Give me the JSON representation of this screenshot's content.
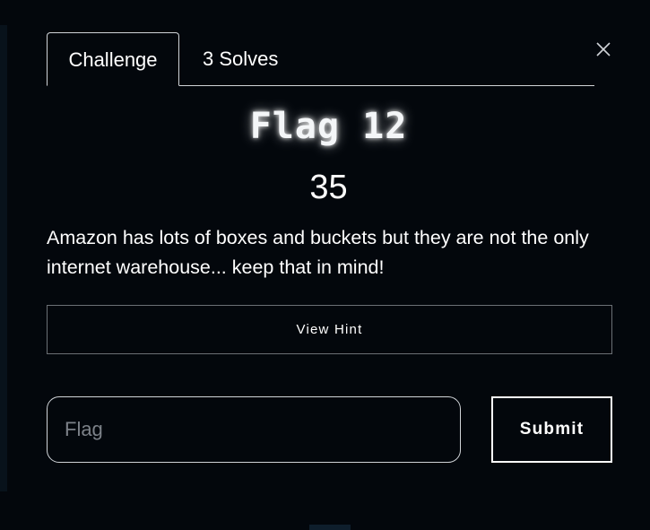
{
  "tabs": [
    {
      "label": "Challenge",
      "active": true
    },
    {
      "label": "3 Solves",
      "active": false
    }
  ],
  "close_icon": "close-icon",
  "challenge": {
    "name": "Flag 12",
    "points": "35",
    "description": "Amazon has lots of boxes and buckets but they are not the only internet warehouse... keep that in mind!"
  },
  "hint_button": {
    "label": "View Hint"
  },
  "flag_input": {
    "placeholder": "Flag",
    "value": ""
  },
  "submit_button": {
    "label": "Submit"
  },
  "colors": {
    "background": "#03070c",
    "text": "#ffffff",
    "border": "#d0d4d8",
    "placeholder": "#7c8188"
  }
}
